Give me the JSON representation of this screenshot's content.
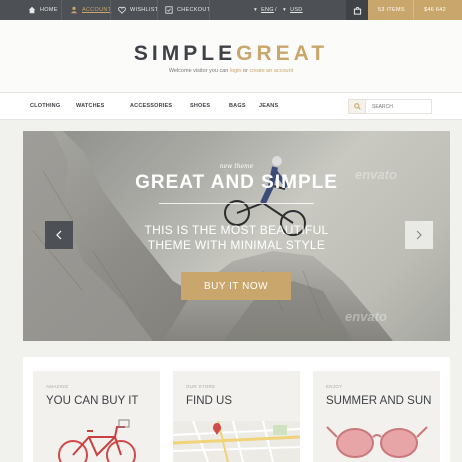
{
  "topbar": {
    "home": "HOME",
    "account": "ACCOUNT",
    "wishlist": "WISHLIST",
    "checkout": "CHECKOUT",
    "lang": "ENG",
    "currency": "USD",
    "cart_items": "53 ITEMS",
    "cart_total": "$46 642"
  },
  "header": {
    "logo_part1": "SIMPLE",
    "logo_part2": "GREAT",
    "welcome_prefix": "Welcome visitor you can ",
    "login": "login",
    "or": " or ",
    "create_account": "create an account"
  },
  "nav": {
    "items": [
      "CLOTHING",
      "WATCHES",
      "ACCESSORIES",
      "SHOES",
      "BAGS",
      "JEANS"
    ],
    "search_placeholder": "SEARCH"
  },
  "hero": {
    "small": "new theme",
    "title": "GREAT AND SIMPLE",
    "sub1": "THIS IS THE MOST BEAUTIFUL",
    "sub2": "THEME WITH MINIMAL STYLE",
    "button": "BUY IT NOW",
    "watermark": "envato"
  },
  "cards": [
    {
      "small": "AMAZING",
      "title": "YOU CAN BUY IT"
    },
    {
      "small": "OUR STORE",
      "title": "FIND US"
    },
    {
      "small": "ENJOY",
      "title": "SUMMER AND SUN"
    }
  ],
  "colors": {
    "accent": "#c9a66b",
    "dark": "#4d5054"
  }
}
